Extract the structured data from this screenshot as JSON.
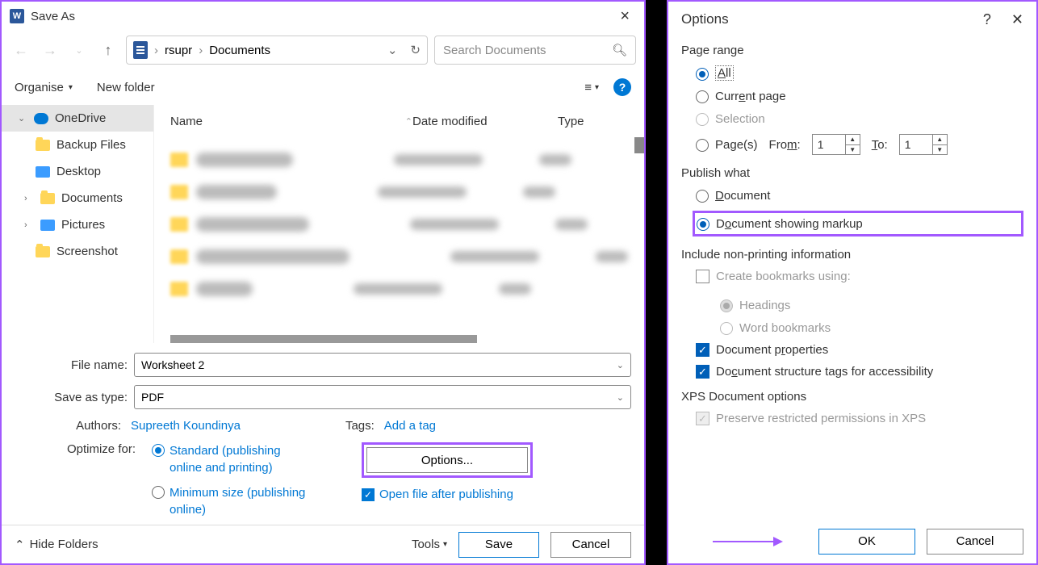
{
  "save_dialog": {
    "title": "Save As",
    "nav": {
      "back": "←",
      "forward": "→",
      "up": "↑"
    },
    "address": {
      "root": "rsupr",
      "sep": "›",
      "folder": "Documents"
    },
    "search_placeholder": "Search Documents",
    "toolbar": {
      "organise": "Organise",
      "new_folder": "New folder"
    },
    "sidebar": {
      "onedrive": "OneDrive",
      "backup": "Backup Files",
      "desktop": "Desktop",
      "documents": "Documents",
      "pictures": "Pictures",
      "screenshot": "Screenshot"
    },
    "columns": {
      "name": "Name",
      "date": "Date modified",
      "type": "Type"
    },
    "file_name_label": "File name:",
    "file_name_value": "Worksheet 2",
    "save_type_label": "Save as type:",
    "save_type_value": "PDF",
    "authors_label": "Authors:",
    "authors_value": "Supreeth Koundinya",
    "tags_label": "Tags:",
    "tags_value": "Add a tag",
    "optimize_label": "Optimize for:",
    "optimize_standard": "Standard (publishing online and printing)",
    "optimize_min": "Minimum size (publishing online)",
    "options_button": "Options...",
    "open_after": "Open file after publishing",
    "hide_folders": "Hide Folders",
    "tools": "Tools",
    "save": "Save",
    "cancel": "Cancel"
  },
  "options_dialog": {
    "title": "Options",
    "page_range": {
      "title": "Page range",
      "all": "All",
      "current": "Current page",
      "selection": "Selection",
      "pages": "Page(s)",
      "from_label": "From:",
      "from_val": "1",
      "to_label": "To:",
      "to_val": "1"
    },
    "publish_what": {
      "title": "Publish what",
      "document": "Document",
      "document_markup": "Document showing markup"
    },
    "include": {
      "title": "Include non-printing information",
      "bookmarks": "Create bookmarks using:",
      "headings": "Headings",
      "word_bookmarks": "Word bookmarks",
      "doc_props": "Document properties",
      "struct_tags": "Document structure tags for accessibility"
    },
    "xps": {
      "title": "XPS Document options",
      "preserve": "Preserve restricted permissions in XPS"
    },
    "ok": "OK",
    "cancel": "Cancel"
  }
}
